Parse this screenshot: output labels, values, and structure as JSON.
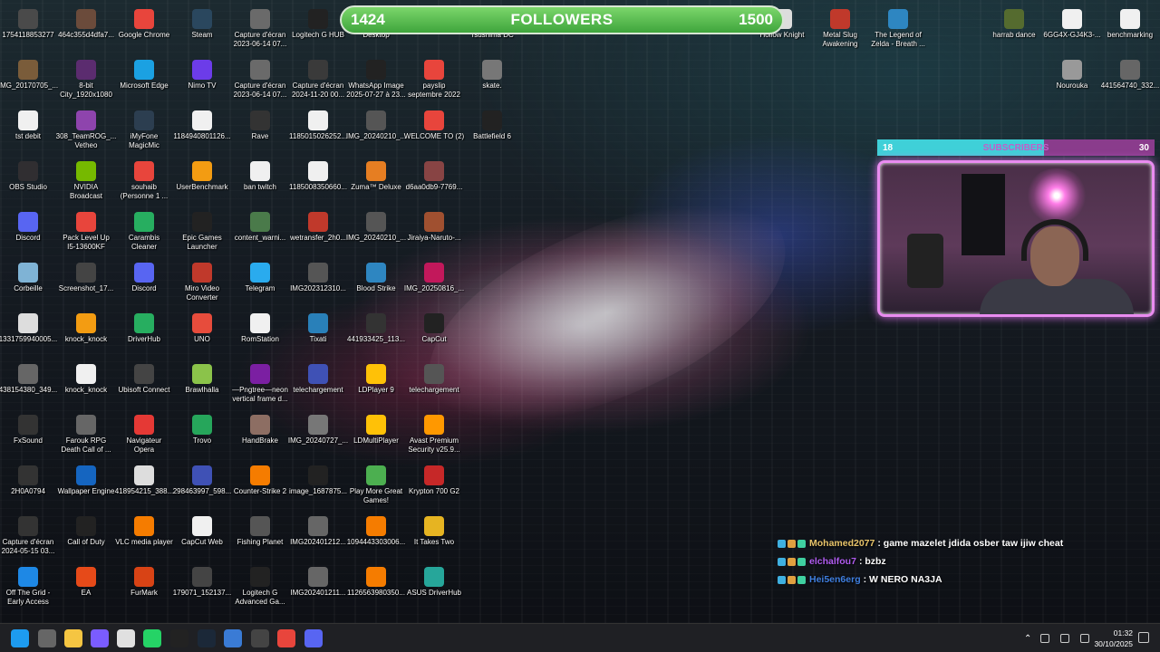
{
  "followers": {
    "current": "1424",
    "title": "FOLLOWERS",
    "goal": "1500",
    "progress_fraction": 0.95
  },
  "subscribers": {
    "current": "18",
    "title": "SUBSCRIBERS",
    "goal": "30",
    "progress_fraction": 0.6
  },
  "desktop_icons": [
    {
      "label": "1754118853277",
      "color": "#4a4a4a"
    },
    {
      "label": "464c355d4dfa7...",
      "color": "#6b4b3b"
    },
    {
      "label": "Google Chrome",
      "color": "#e8453c"
    },
    {
      "label": "Steam",
      "color": "#2a475e"
    },
    {
      "label": "Capture d'écran\n2023-06-14 07...",
      "color": "#6a6a6a"
    },
    {
      "label": "Logitech G HUB",
      "color": "#222"
    },
    {
      "label": "Desktop",
      "color": "#3d5a80"
    },
    {
      "label": "Tsushima DC",
      "color": "#555"
    },
    {
      "label": "Hollow Knight",
      "color": "#ddd"
    },
    {
      "label": "Metal Slug\nAwakening",
      "color": "#c0392b"
    },
    {
      "label": "The Legend of\nZelda - Breath ...",
      "color": "#2e86c1"
    },
    {
      "label": "harrab dance",
      "color": "#556b2f"
    },
    {
      "label": "6GG4X-GJ4K3-...",
      "color": "#f0f0f0"
    },
    {
      "label": "benchmarking",
      "color": "#f0f0f0"
    },
    {
      "label": "IMG_20170705_...",
      "color": "#7a5c3a"
    },
    {
      "label": "8-bit\nCity_1920x1080",
      "color": "#5b2c6f"
    },
    {
      "label": "Microsoft Edge",
      "color": "#1ba1e2"
    },
    {
      "label": "Nimo TV",
      "color": "#6c3ce9"
    },
    {
      "label": "Capture d'écran\n2023-06-14 07...",
      "color": "#6a6a6a"
    },
    {
      "label": "Capture d'écran\n2024-11-20 00...",
      "color": "#3a3a3a"
    },
    {
      "label": "WhatsApp Image\n2025-07-27 à 23...",
      "color": "#222"
    },
    {
      "label": "payslip\nseptembre 2022",
      "color": "#e8453c"
    },
    {
      "label": "skate.",
      "color": "#777"
    },
    {
      "label": "Nourouka",
      "color": "#999"
    },
    {
      "label": "441564740_332...",
      "color": "#666"
    },
    {
      "label": "tst debit",
      "color": "#f0f0f0"
    },
    {
      "label": "308_TeamROG_...\nVetheo",
      "color": "#8e44ad"
    },
    {
      "label": "iMyFone\nMagicMic",
      "color": "#2c3e50"
    },
    {
      "label": "1184940801126...",
      "color": "#f0f0f0"
    },
    {
      "label": "Rave",
      "color": "#333"
    },
    {
      "label": "1185015026252...",
      "color": "#f0f0f0"
    },
    {
      "label": "IMG_20240210_...",
      "color": "#555"
    },
    {
      "label": "WELCOME TO (2)",
      "color": "#e8453c"
    },
    {
      "label": "Battlefield 6",
      "color": "#222"
    },
    {
      "label": "OBS Studio",
      "color": "#302e31"
    },
    {
      "label": "NVIDIA\nBroadcast",
      "color": "#76b900"
    },
    {
      "label": "souhaib\n(Personne 1 ...",
      "color": "#e8453c"
    },
    {
      "label": "UserBenchmark",
      "color": "#f39c12"
    },
    {
      "label": "ban twitch",
      "color": "#f0f0f0"
    },
    {
      "label": "1185008350660...",
      "color": "#f0f0f0"
    },
    {
      "label": "Zuma™ Deluxe",
      "color": "#e67e22"
    },
    {
      "label": "d6aa0db9-7769...",
      "color": "#884444"
    },
    {
      "label": "Discord",
      "color": "#5865f2"
    },
    {
      "label": "Pack Level Up\nI5-13600KF",
      "color": "#e8453c"
    },
    {
      "label": "Carambis\nCleaner",
      "color": "#27ae60"
    },
    {
      "label": "Epic Games\nLauncher",
      "color": "#222"
    },
    {
      "label": "content_warni...",
      "color": "#4a7a4a"
    },
    {
      "label": "wetransfer_2h0...",
      "color": "#c0392b"
    },
    {
      "label": "IMG_20240210_...",
      "color": "#555"
    },
    {
      "label": "Jiraiya-Naruto-...",
      "color": "#a05030"
    },
    {
      "label": "Corbeille",
      "color": "#7fb3d5"
    },
    {
      "label": "Screenshot_17...",
      "color": "#444"
    },
    {
      "label": "Discord",
      "color": "#5865f2"
    },
    {
      "label": "Miro Video\nConverter",
      "color": "#c0392b"
    },
    {
      "label": "Telegram",
      "color": "#2aabee"
    },
    {
      "label": "IMG202312310...",
      "color": "#555"
    },
    {
      "label": "Blood Strike",
      "color": "#2e86c1"
    },
    {
      "label": "IMG_20250816_...",
      "color": "#c2185b"
    },
    {
      "label": "1331759940005...",
      "color": "#ddd"
    },
    {
      "label": "knock_knock",
      "color": "#f39c12"
    },
    {
      "label": "DriverHub",
      "color": "#27ae60"
    },
    {
      "label": "UNO",
      "color": "#e74c3c"
    },
    {
      "label": "RomStation",
      "color": "#f0f0f0"
    },
    {
      "label": "Tixati",
      "color": "#2980b9"
    },
    {
      "label": "441933425_113...",
      "color": "#333"
    },
    {
      "label": "CapCut",
      "color": "#222"
    },
    {
      "label": "438154380_349...",
      "color": "#666"
    },
    {
      "label": "knock_knock",
      "color": "#f0f0f0"
    },
    {
      "label": "Ubisoft Connect",
      "color": "#444"
    },
    {
      "label": "Brawlhalla",
      "color": "#8bc34a"
    },
    {
      "label": "—Pngtree—neon\nvertical frame d...",
      "color": "#7b1fa2"
    },
    {
      "label": "telechargement",
      "color": "#3f51b5"
    },
    {
      "label": "LDPlayer 9",
      "color": "#ffc107"
    },
    {
      "label": "telechargement",
      "color": "#555"
    },
    {
      "label": "FxSound",
      "color": "#333"
    },
    {
      "label": "Farouk RPG\nDeath Call of ...",
      "color": "#666"
    },
    {
      "label": "Navigateur\nOpera",
      "color": "#e53935"
    },
    {
      "label": "Trovo",
      "color": "#26a65b"
    },
    {
      "label": "HandBrake",
      "color": "#8d6e63"
    },
    {
      "label": "IMG_20240727_...",
      "color": "#777"
    },
    {
      "label": "LDMultiPlayer",
      "color": "#ffc107"
    },
    {
      "label": "Avast Premium\nSecurity v25.9...",
      "color": "#ff9800"
    },
    {
      "label": "2H0A0794",
      "color": "#333"
    },
    {
      "label": "Wallpaper Engine",
      "color": "#1565c0"
    },
    {
      "label": "418954215_388...",
      "color": "#ddd"
    },
    {
      "label": "298463997_598...",
      "color": "#3f51b5"
    },
    {
      "label": "Counter-Strike 2",
      "color": "#f57c00"
    },
    {
      "label": "image_1687875...",
      "color": "#222"
    },
    {
      "label": "Play More Great\nGames!",
      "color": "#4caf50"
    },
    {
      "label": "Krypton 700 G2",
      "color": "#c62828"
    },
    {
      "label": "Capture d'écran\n2024-05-15 03...",
      "color": "#333"
    },
    {
      "label": "Call of Duty",
      "color": "#222"
    },
    {
      "label": "VLC media player",
      "color": "#f57c00"
    },
    {
      "label": "CapCut Web",
      "color": "#f0f0f0"
    },
    {
      "label": "Fishing Planet",
      "color": "#555"
    },
    {
      "label": "IMG202401212...",
      "color": "#666"
    },
    {
      "label": "1094443303006...",
      "color": "#f57c00"
    },
    {
      "label": "It Takes Two",
      "color": "#e6b422"
    },
    {
      "label": "Off The Grid -\nEarly Access",
      "color": "#1e88e5"
    },
    {
      "label": "EA",
      "color": "#e64a19"
    },
    {
      "label": "FurMark",
      "color": "#d84315"
    },
    {
      "label": "179071_152137...",
      "color": "#444"
    },
    {
      "label": "Logitech G\nAdvanced Ga...",
      "color": "#222"
    },
    {
      "label": "IMG202401211...",
      "color": "#666"
    },
    {
      "label": "1126563980350...",
      "color": "#f57c00"
    },
    {
      "label": "ASUS DriverHub",
      "color": "#26a69a"
    }
  ],
  "chat": [
    {
      "user": "Mohamed2077",
      "user_color": "#e8c46a",
      "message": ": game mazelet jdida osber taw ijiw cheat"
    },
    {
      "user": "elchalfou7",
      "user_color": "#b05cf0",
      "message": ": bzbz"
    },
    {
      "user": "Hei5en6erg",
      "user_color": "#3f7fe0",
      "message": ": W NERO NA3JA"
    }
  ],
  "taskbar": {
    "apps": [
      "start-icon",
      "task-view-icon",
      "file-explorer-icon",
      "cortana-icon",
      "snipping-icon",
      "whatsapp-icon",
      "epic-games-icon",
      "steam-icon",
      "ea-icon",
      "logitech-icon",
      "chrome-icon",
      "discord-icon"
    ],
    "time": "01:32",
    "date": "30/10/2025"
  }
}
